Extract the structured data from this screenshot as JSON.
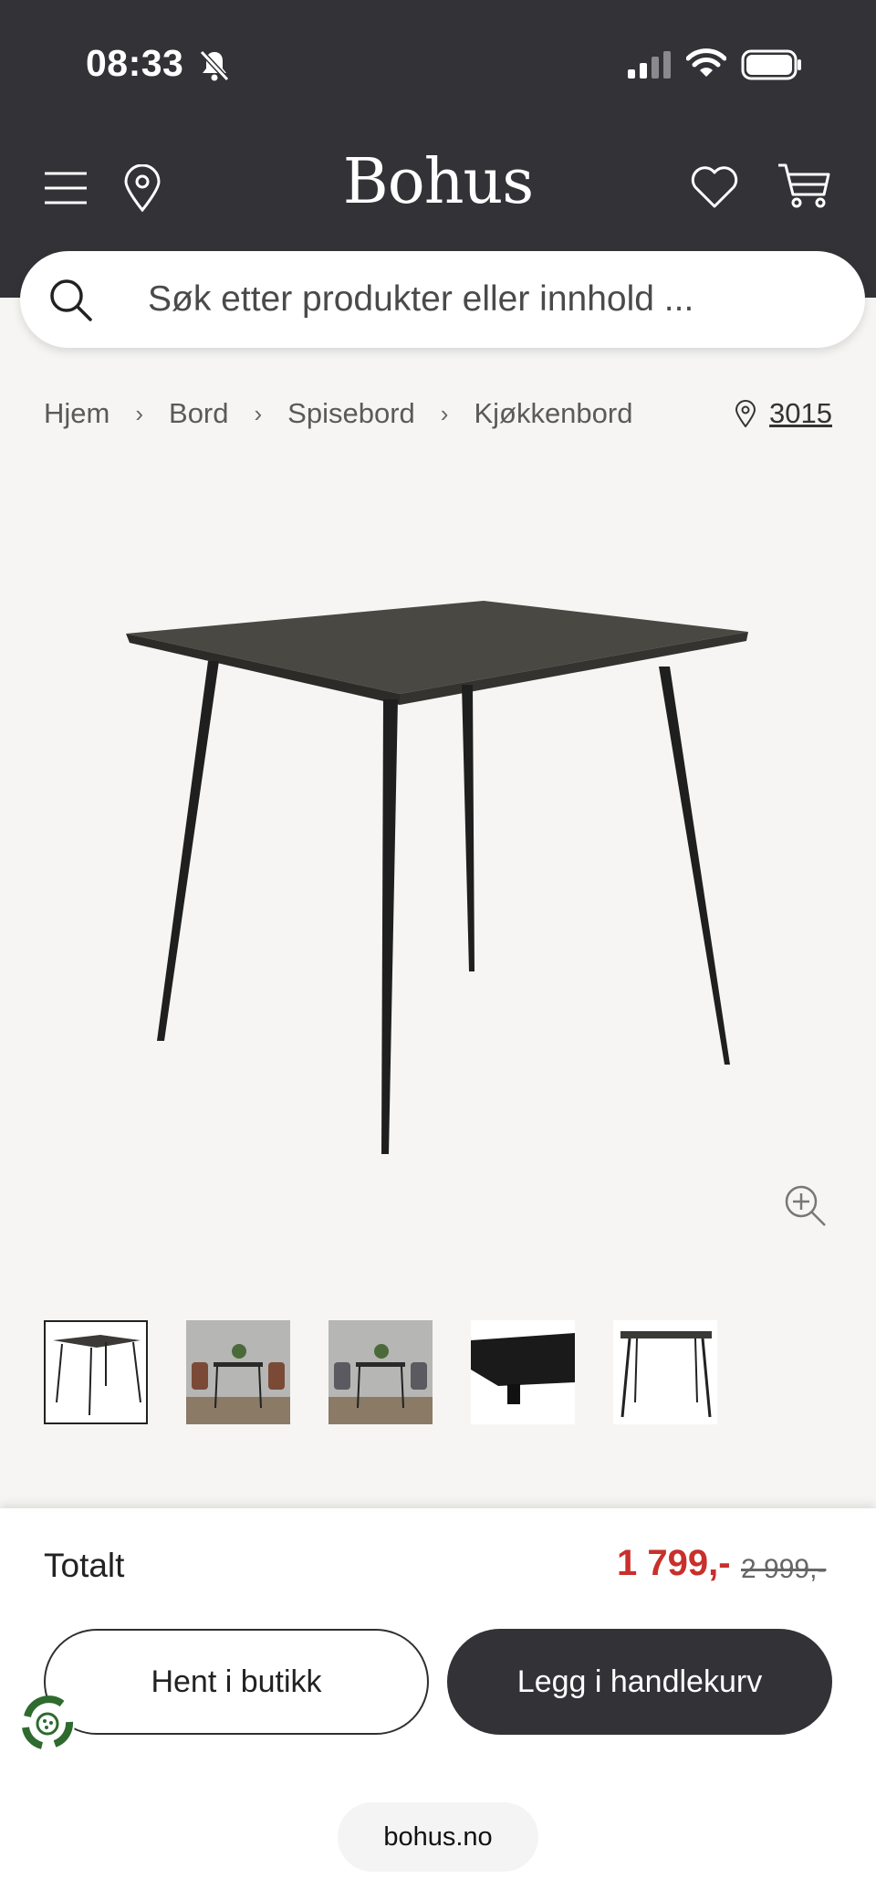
{
  "status_bar": {
    "time": "08:33",
    "icons": [
      "bell-muted-icon",
      "signal-icon",
      "wifi-icon",
      "battery-icon"
    ]
  },
  "header": {
    "logo": "Bohus",
    "icons": [
      "menu-icon",
      "location-icon",
      "heart-icon",
      "cart-icon"
    ],
    "colors": {
      "background": "#323237",
      "text": "#ffffff"
    }
  },
  "search": {
    "placeholder": "Søk etter produkter eller innhold ..."
  },
  "breadcrumb": {
    "items": [
      "Hjem",
      "Bord",
      "Spisebord",
      "Kjøkkenbord"
    ]
  },
  "store": {
    "postcode": "3015"
  },
  "gallery": {
    "thumbnail_count": 5,
    "active_index": 0
  },
  "purchase": {
    "total_label": "Totalt",
    "price": "1 799,-",
    "original_price": "2 999,-",
    "pickup_button": "Hent i butikk",
    "cart_button": "Legg i handlekurv",
    "colors": {
      "price": "#c8302c",
      "primary_button": "#323237"
    }
  },
  "browser": {
    "url": "bohus.no"
  }
}
